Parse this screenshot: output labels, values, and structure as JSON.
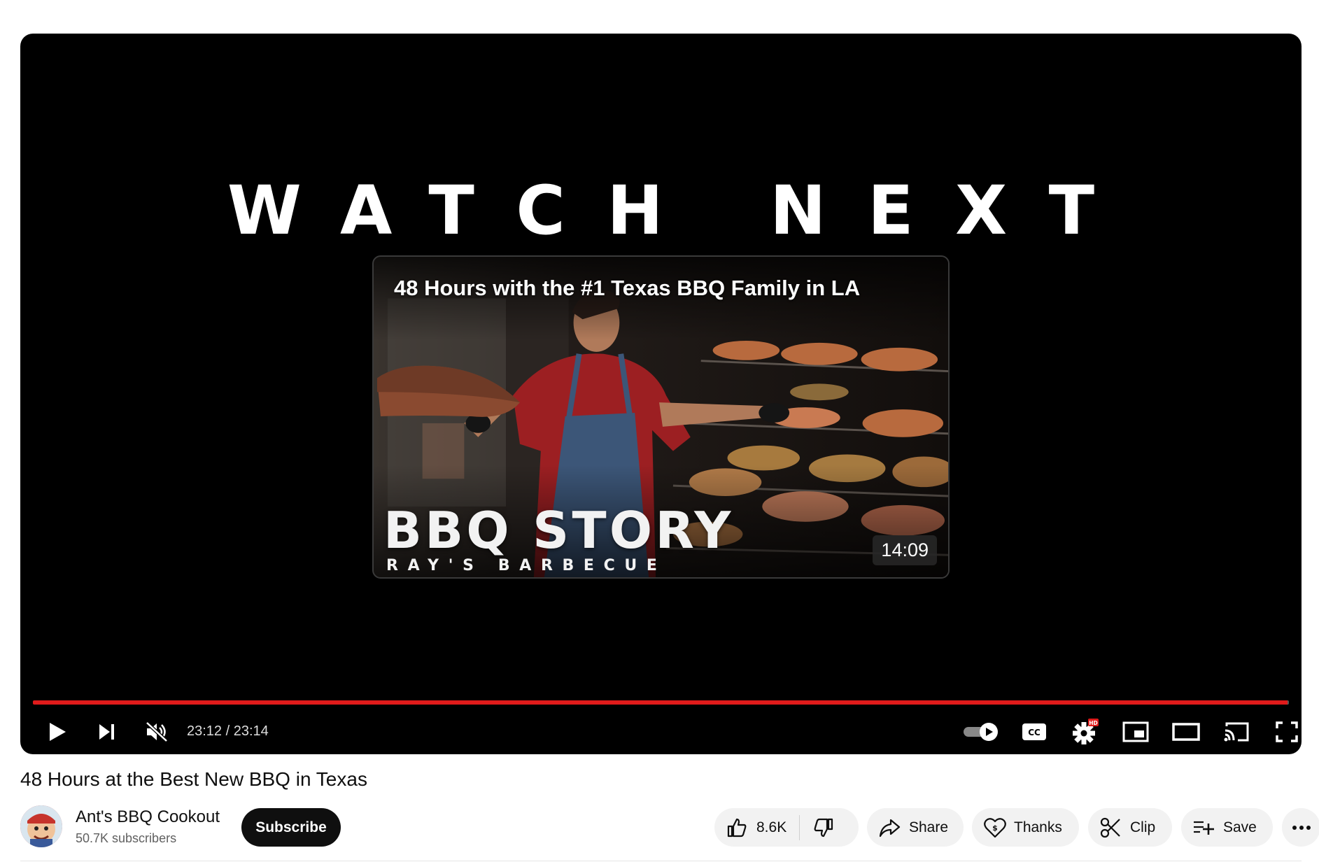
{
  "player": {
    "overlay_heading": "WATCH NEXT",
    "endcard": {
      "title": "48 Hours with the #1 Texas BBQ Family in LA",
      "thumb_text_big": "BBQ STORY",
      "thumb_text_small": "RAY'S BARBECUE",
      "duration": "14:09"
    },
    "progress_percent": 99.9,
    "controls": {
      "time": "23:12 / 23:14",
      "settings_badge": "HD",
      "autoplay": "on",
      "muted": true
    },
    "icons": [
      "play-icon",
      "next-icon",
      "mute-icon",
      "autoplay-toggle",
      "cc-icon",
      "settings-icon",
      "miniplayer-icon",
      "theater-icon",
      "cast-icon",
      "fullscreen-icon"
    ]
  },
  "video": {
    "title": "48 Hours at the Best New BBQ in Texas"
  },
  "channel": {
    "name": "Ant's BBQ Cookout",
    "subscribers": "50.7K subscribers",
    "subscribe_label": "Subscribe"
  },
  "actions": {
    "like_count": "8.6K",
    "share_label": "Share",
    "thanks_label": "Thanks",
    "clip_label": "Clip",
    "save_label": "Save"
  },
  "colors": {
    "progress": "#e01b1b",
    "pill_bg": "#f2f2f2",
    "subscribe_bg": "#0f0f0f"
  }
}
